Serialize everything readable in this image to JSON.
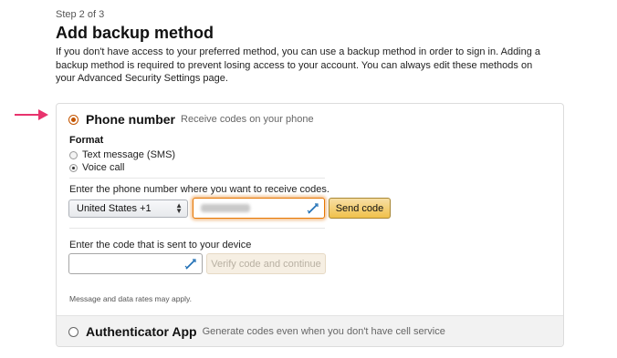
{
  "header": {
    "step": "Step 2 of 3",
    "title": "Add backup method",
    "description": "If you don't have access to your preferred method, you can use a backup method in order to sign in. Adding a backup method is required to prevent losing access to your account. You can always edit these methods on your Advanced Security Settings page."
  },
  "options": {
    "phone": {
      "title": "Phone number",
      "subtitle": "Receive codes on your phone",
      "selected": true
    },
    "authenticator": {
      "title": "Authenticator App",
      "subtitle": "Generate codes even when you don't have cell service",
      "selected": false
    }
  },
  "format": {
    "label": "Format",
    "sms_label": "Text message (SMS)",
    "voice_label": "Voice call",
    "selected": "voice"
  },
  "phone_entry": {
    "label": "Enter the phone number where you want to receive codes.",
    "country_value": "United States +1",
    "send_button": "Send code"
  },
  "code_entry": {
    "label": "Enter the code that is sent to your device",
    "verify_button": "Verify code and continue"
  },
  "note": "Message and data rates may apply.",
  "colors": {
    "accent": "#e77600",
    "arrow": "#e8336d",
    "primary_button": "#f0c14b"
  },
  "icons": {
    "pointer": "pink-arrow-icon",
    "pen": "pen-icon"
  }
}
